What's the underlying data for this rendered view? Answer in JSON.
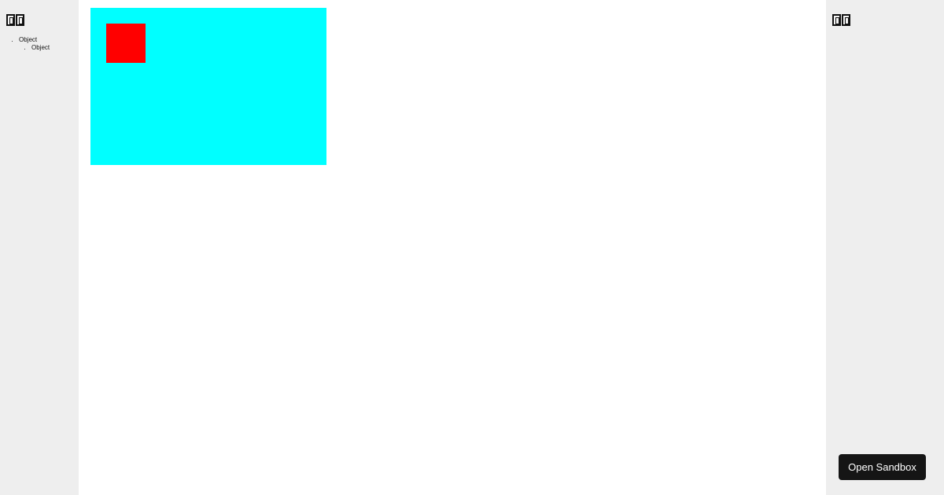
{
  "left_panel": {
    "heading": "□□",
    "tree": [
      {
        "label": "Object",
        "children": [
          {
            "label": "Object"
          }
        ]
      }
    ]
  },
  "right_panel": {
    "heading": "□□"
  },
  "stage": {
    "outer_box_color": "#00ffff",
    "inner_box_color": "#ff0000"
  },
  "sandbox_button": {
    "label": "Open Sandbox",
    "background": "#151515"
  },
  "colors": {
    "panel_background": "#eeeeee",
    "stage_background": "#ffffff"
  }
}
